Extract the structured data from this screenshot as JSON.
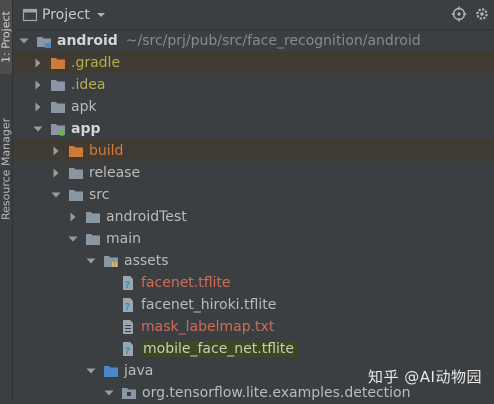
{
  "side_tabs": {
    "project": "1: Project",
    "resource": "Resource Manager"
  },
  "header": {
    "title": "Project"
  },
  "tree": [
    {
      "label": "android",
      "path": "~/src/prj/pub/src/face_recognition/android"
    },
    {
      "label": ".gradle"
    },
    {
      "label": ".idea"
    },
    {
      "label": "apk"
    },
    {
      "label": "app"
    },
    {
      "label": "build"
    },
    {
      "label": "release"
    },
    {
      "label": "src"
    },
    {
      "label": "androidTest"
    },
    {
      "label": "main"
    },
    {
      "label": "assets"
    },
    {
      "label": "facenet.tflite"
    },
    {
      "label": "facenet_hiroki.tflite"
    },
    {
      "label": "mask_labelmap.txt"
    },
    {
      "label": "mobile_face_net.tflite"
    },
    {
      "label": "java"
    },
    {
      "label": "org.tensorflow.lite.examples.detection"
    }
  ],
  "watermark": "知乎 @AI动物园",
  "colors": {
    "background": "#3c3f41",
    "text": "#bbbbbb",
    "excluded_folder": "#b6ae4e",
    "build_folder": "#d07b3a",
    "modified_file": "#cc6d5a",
    "selection_highlight": "#3b4a1e",
    "row_highlight": "#403c33"
  }
}
